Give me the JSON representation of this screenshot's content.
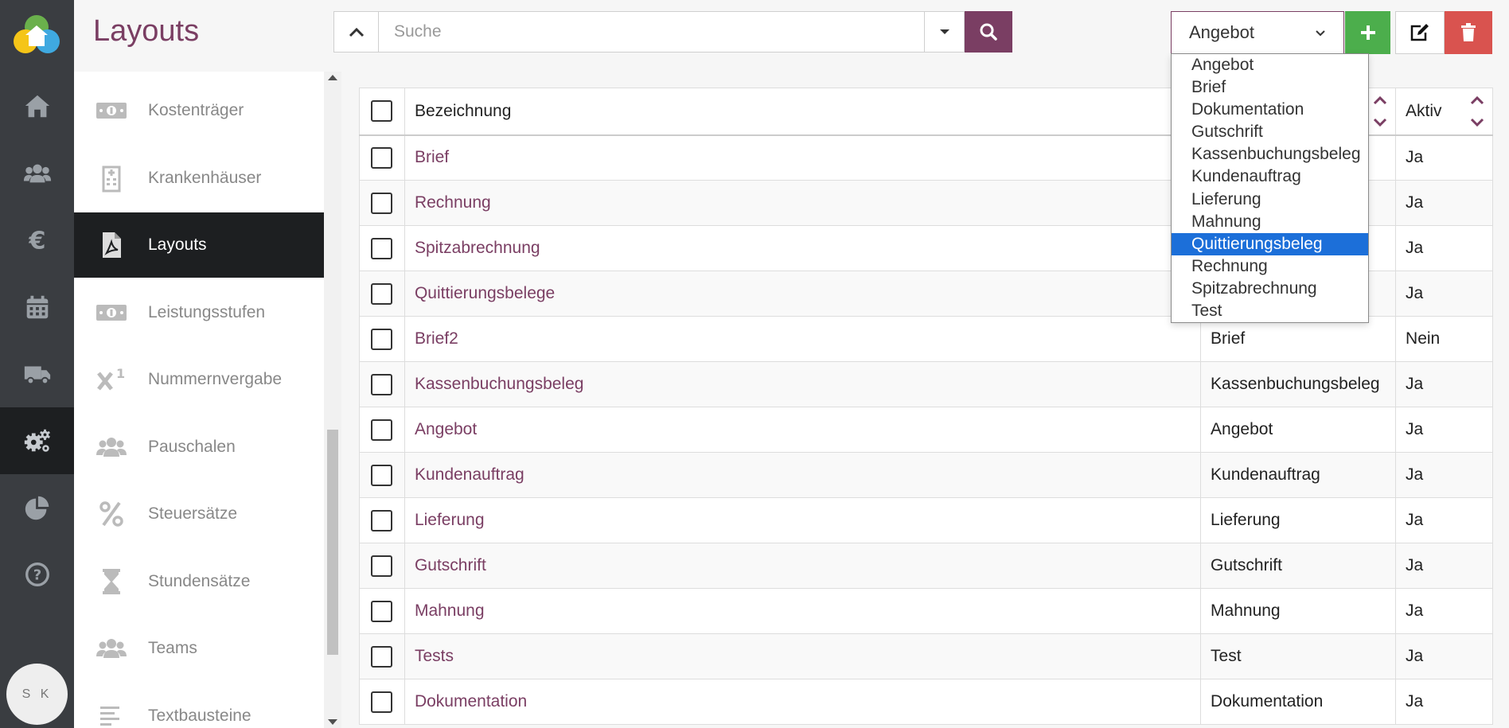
{
  "header": {
    "title": "Layouts",
    "search_placeholder": "Suche",
    "selected_type": "Angebot"
  },
  "rail": {
    "avatar_initials": "S K",
    "items": [
      "home-icon",
      "users-icon",
      "euro-icon",
      "calendar-icon",
      "truck-icon",
      "gears-icon",
      "pie-chart-icon",
      "help-icon"
    ]
  },
  "sidebar": {
    "items": [
      {
        "label": "Kostenträger",
        "icon": "money-icon"
      },
      {
        "label": "Krankenhäuser",
        "icon": "hospital-icon"
      },
      {
        "label": "Layouts",
        "icon": "pdf-file-icon",
        "active": true
      },
      {
        "label": "Leistungsstufen",
        "icon": "money-icon"
      },
      {
        "label": "Nummernvergabe",
        "icon": "superscript-icon"
      },
      {
        "label": "Pauschalen",
        "icon": "users-icon"
      },
      {
        "label": "Steuersätze",
        "icon": "percent-icon"
      },
      {
        "label": "Stundensätze",
        "icon": "hourglass-icon"
      },
      {
        "label": "Teams",
        "icon": "users-icon"
      },
      {
        "label": "Textbausteine",
        "icon": "align-left-icon"
      }
    ]
  },
  "dropdown": {
    "options": [
      "Angebot",
      "Brief",
      "Dokumentation",
      "Gutschrift",
      "Kassenbuchungsbeleg",
      "Kundenauftrag",
      "Lieferung",
      "Mahnung",
      "Quittierungsbeleg",
      "Rechnung",
      "Spitzabrechnung",
      "Test"
    ],
    "highlighted": "Quittierungsbeleg"
  },
  "table": {
    "columns": {
      "name": "Bezeichnung",
      "type": "",
      "active": "Aktiv"
    },
    "rows": [
      {
        "name": "Brief",
        "type": "",
        "active": "Ja"
      },
      {
        "name": "Rechnung",
        "type": "",
        "active": "Ja"
      },
      {
        "name": "Spitzabrechnung",
        "type": "",
        "active": "Ja"
      },
      {
        "name": "Quittierungsbelege",
        "type": "",
        "active": "Ja"
      },
      {
        "name": "Brief2",
        "type": "Brief",
        "active": "Nein"
      },
      {
        "name": "Kassenbuchungsbeleg",
        "type": "Kassenbuchungsbeleg",
        "active": "Ja"
      },
      {
        "name": "Angebot",
        "type": "Angebot",
        "active": "Ja"
      },
      {
        "name": "Kundenauftrag",
        "type": "Kundenauftrag",
        "active": "Ja"
      },
      {
        "name": "Lieferung",
        "type": "Lieferung",
        "active": "Ja"
      },
      {
        "name": "Gutschrift",
        "type": "Gutschrift",
        "active": "Ja"
      },
      {
        "name": "Mahnung",
        "type": "Mahnung",
        "active": "Ja"
      },
      {
        "name": "Tests",
        "type": "Test",
        "active": "Ja"
      },
      {
        "name": "Dokumentation",
        "type": "Dokumentation",
        "active": "Ja"
      }
    ]
  },
  "colors": {
    "brand": "#7a3e63",
    "rail_bg": "#3a3d41",
    "rail_active": "#1d1f21",
    "add_green": "#4cae4c",
    "delete_red": "#d9534f",
    "highlight_blue": "#1c6fd9"
  }
}
